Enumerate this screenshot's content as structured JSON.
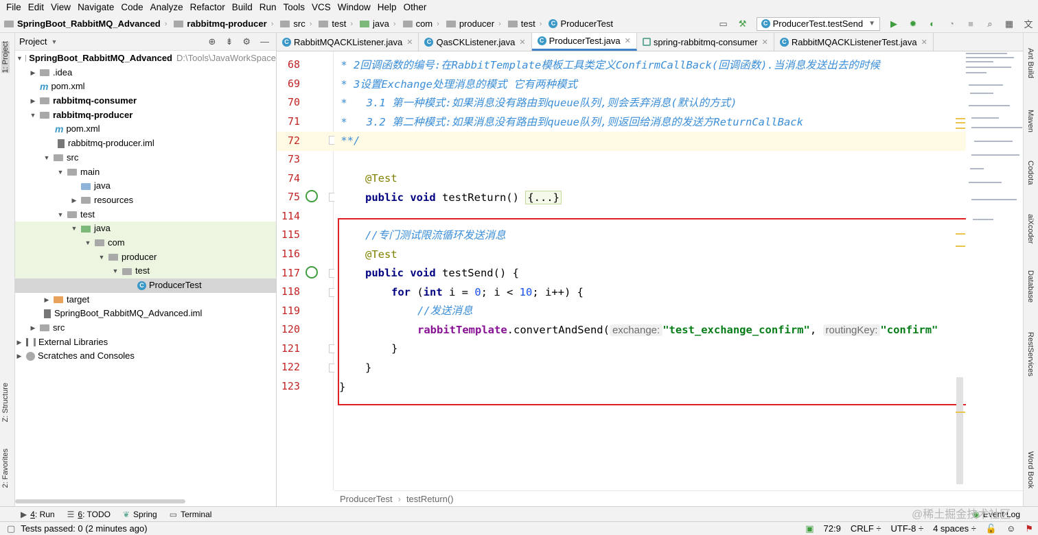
{
  "menu": [
    "File",
    "Edit",
    "View",
    "Navigate",
    "Code",
    "Analyze",
    "Refactor",
    "Build",
    "Run",
    "Tools",
    "VCS",
    "Window",
    "Help",
    "Other"
  ],
  "navbar": {
    "crumbs": [
      "SpringBoot_RabbitMQ_Advanced",
      "rabbitmq-producer",
      "src",
      "test",
      "java",
      "com",
      "producer",
      "test",
      "ProducerTest"
    ],
    "run_config": "ProducerTest.testSend"
  },
  "left_tabs": [
    "1: Project",
    "Z: Structure",
    "2: Favorites"
  ],
  "right_tabs": [
    "Ant Build",
    "Maven",
    "Codota",
    "aiXcoder",
    "Database",
    "RestServices",
    "Word Book"
  ],
  "project": {
    "header": "Project",
    "rows": [
      {
        "label": "SpringBoot_RabbitMQ_Advanced",
        "extra": "D:\\Tools\\JavaWorkSpace",
        "bold": true
      },
      {
        "label": ".idea"
      },
      {
        "label": "pom.xml"
      },
      {
        "label": "rabbitmq-consumer",
        "bold": true
      },
      {
        "label": "rabbitmq-producer",
        "bold": true
      },
      {
        "label": "pom.xml"
      },
      {
        "label": "rabbitmq-producer.iml"
      },
      {
        "label": "src"
      },
      {
        "label": "main"
      },
      {
        "label": "java"
      },
      {
        "label": "resources"
      },
      {
        "label": "test"
      },
      {
        "label": "java"
      },
      {
        "label": "com"
      },
      {
        "label": "producer"
      },
      {
        "label": "test"
      },
      {
        "label": "ProducerTest"
      },
      {
        "label": "target"
      },
      {
        "label": "SpringBoot_RabbitMQ_Advanced.iml"
      },
      {
        "label": "src"
      },
      {
        "label": "External Libraries"
      },
      {
        "label": "Scratches and Consoles"
      }
    ]
  },
  "tabs": [
    "RabbitMQACKListener.java",
    "QasCKListener.java",
    "ProducerTest.java",
    "spring-rabbitmq-consumer",
    "RabbitMQACKListenerTest.java"
  ],
  "editor": {
    "line_numbers": [
      "68",
      "69",
      "70",
      "71",
      "72",
      "73",
      "74",
      "75",
      "114",
      "115",
      "116",
      "117",
      "118",
      "119",
      "120",
      "121",
      "122",
      "123"
    ],
    "l68": " * 2回调函数的编号:在RabbitTemplate模板工具类定义ConfirmCallBack(回调函数).当消息发送出去的时候",
    "l69": " * 3设置Exchange处理消息的模式 它有两种模式",
    "l70": " *   3.1 第一种模式:如果消息没有路由到queue队列,则会丢弃消息(默认的方式)",
    "l71": " *   3.2 第二种模式:如果消息没有路由到queue队列,则返回给消息的发送方ReturnCallBack",
    "l72": " **/",
    "l74_ann": "@Test",
    "l75_kw": "public void ",
    "l75_name": "testReturn() ",
    "l75_fold": "{...}",
    "l115": "//专门测试限流循环发送消息",
    "l116": "@Test",
    "l117_kw": "public void ",
    "l117_rest": "testSend() {",
    "l118_kw1": "for ",
    "l118_a": "(",
    "l118_kw2": "int ",
    "l118_b": "i = ",
    "l118_n1": "0",
    "l118_c": "; i < ",
    "l118_n2": "10",
    "l118_d": "; i++) {",
    "l119": "//发送消息",
    "l120_field": "rabbitTemplate",
    "l120_method": ".convertAndSend(",
    "l120_hint1": "exchange:",
    "l120_str1": "\"test_exchange_confirm\"",
    "l120_comma": ", ",
    "l120_hint2": "routingKey:",
    "l120_str2": "\"confirm\"",
    "l121": "}",
    "l122": "}",
    "l123": "}"
  },
  "bottom_breadcrumb": [
    "ProducerTest",
    "testReturn()"
  ],
  "tool_windows": [
    {
      "num": "4",
      "label": ": Run"
    },
    {
      "num": "6",
      "label": ": TODO"
    },
    {
      "num": "",
      "label": "Spring"
    },
    {
      "num": "",
      "label": "Terminal"
    },
    {
      "num": "",
      "label": "Event Log"
    }
  ],
  "status": {
    "left": "Tests passed: 0 (2 minutes ago)",
    "position": "72:9",
    "line_sep": "CRLF ÷",
    "encoding": "UTF-8 ÷",
    "indent": "4 spaces ÷"
  },
  "watermark": "@稀土掘金技术社区",
  "colors": {
    "accent": "#4083c9",
    "redbox": "#e02020",
    "line_number": "#c32424",
    "comment": "#3b8ed8"
  }
}
